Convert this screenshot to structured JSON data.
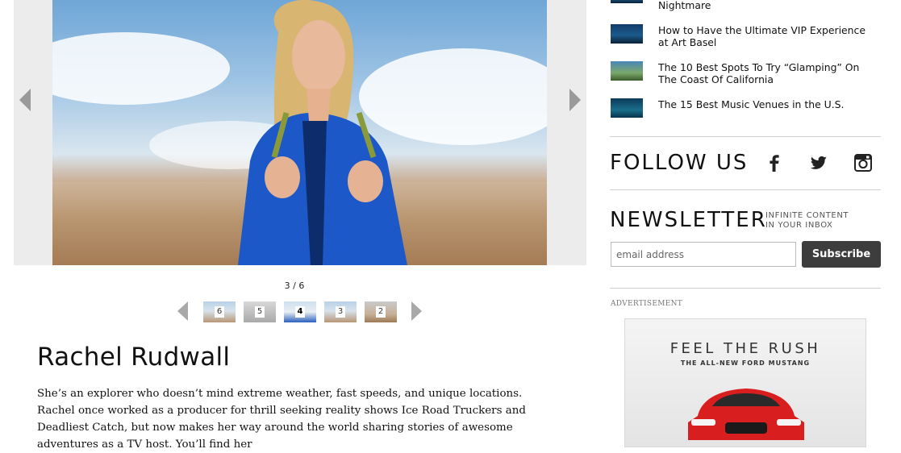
{
  "gallery": {
    "counter": "3 / 6",
    "thumbnails": [
      "6",
      "5",
      "4",
      "3",
      "2"
    ],
    "active_thumbnail": "4"
  },
  "profile": {
    "name": "Rachel Rudwall",
    "bio": "She’s an explorer who doesn’t mind extreme weather, fast speeds, and unique locations. Rachel once worked as a producer for thrill seeking reality shows Ice Road Truckers and Deadliest Catch, but now makes her way around the world sharing stories of awesome adventures as a TV host. You’ll find her"
  },
  "sidebar": {
    "related": [
      {
        "title": "Nightmare"
      },
      {
        "title": "How to Have the Ultimate VIP Experience at Art Basel"
      },
      {
        "title": "The 10 Best Spots To Try “Glamping” On The Coast Of California"
      },
      {
        "title": "The 15 Best Music Venues in the U.S."
      }
    ],
    "follow_label": "FOLLOW US",
    "social_icons": [
      "facebook-icon",
      "twitter-icon",
      "instagram-icon"
    ],
    "newsletter": {
      "label": "NEWSLETTER",
      "tagline_1": "INFINITE CONTENT",
      "tagline_2": "IN YOUR INBOX",
      "placeholder": "email address",
      "button": "Subscribe"
    },
    "ad": {
      "label": "ADVERTISEMENT",
      "headline": "FEEL THE RUSH",
      "subline": "THE ALL-NEW FORD MUSTANG"
    }
  },
  "colors": {
    "button_bg": "#3d3d3d",
    "arrow": "#9a9a9a",
    "divider": "#cfcfcf"
  }
}
